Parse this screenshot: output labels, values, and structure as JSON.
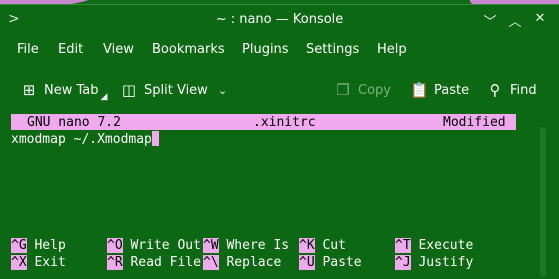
{
  "window": {
    "title": "~ : nano — Konsole",
    "app_icon": "terminal-prompt-icon",
    "controls": {
      "minimize": "﹀",
      "maximize": "︿",
      "close": "✕"
    }
  },
  "menu": [
    "File",
    "Edit",
    "View",
    "Bookmarks",
    "Plugins",
    "Settings",
    "Help"
  ],
  "toolbar": {
    "new_tab": "New Tab",
    "split_view": "Split View",
    "copy": "Copy",
    "paste": "Paste",
    "find": "Find"
  },
  "nano": {
    "version": "GNU nano 7.2",
    "filename": ".xinitrc",
    "state": "Modified",
    "content": "xmodmap ~/.Xmodmap",
    "shortcuts": [
      [
        {
          "key": "^G",
          "label": "Help"
        },
        {
          "key": "^O",
          "label": "Write Out"
        },
        {
          "key": "^W",
          "label": "Where Is"
        },
        {
          "key": "^K",
          "label": "Cut"
        },
        {
          "key": "^T",
          "label": "Execute"
        }
      ],
      [
        {
          "key": "^X",
          "label": "Exit"
        },
        {
          "key": "^R",
          "label": "Read File"
        },
        {
          "key": "^\\",
          "label": "Replace"
        },
        {
          "key": "^U",
          "label": "Paste"
        },
        {
          "key": "^J",
          "label": "Justify"
        }
      ]
    ]
  },
  "colors": {
    "background": "#0c6812",
    "highlight": "#f0a8ee"
  }
}
